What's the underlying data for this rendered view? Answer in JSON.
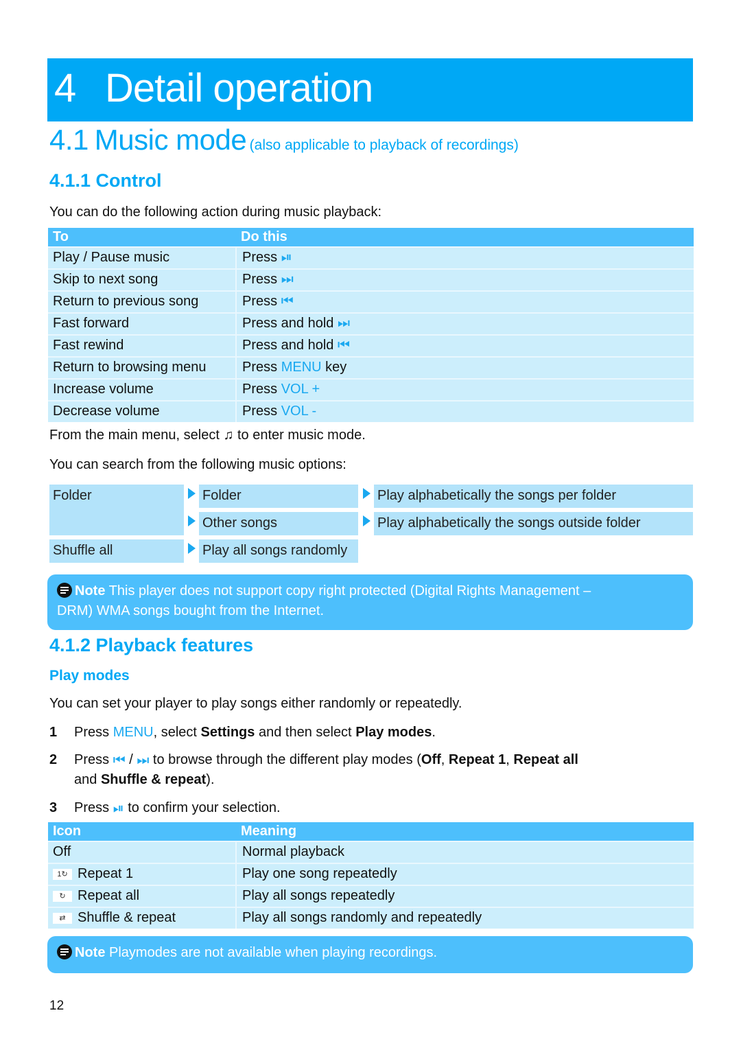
{
  "chapter": {
    "number": "4",
    "title": "Detail operation"
  },
  "section": {
    "number": "4.1",
    "title": "Music mode",
    "subtitle": "(also applicable to playback of recordings)"
  },
  "control": {
    "heading": "4.1.1 Control",
    "intro": "You can do the following action during music playback:",
    "table": {
      "headers": [
        "To",
        "Do this"
      ],
      "rows": [
        {
          "to": "Play / Pause music",
          "do": "Press",
          "key": "",
          "suffix": "",
          "icon": "play-pause-icon"
        },
        {
          "to": "Skip to next song",
          "do": "Press",
          "key": "",
          "suffix": "",
          "icon": "next-track-icon"
        },
        {
          "to": "Return to previous song",
          "do": "Press",
          "key": "",
          "suffix": "",
          "icon": "previous-track-icon"
        },
        {
          "to": "Fast forward",
          "do": "Press and hold",
          "key": "",
          "suffix": "",
          "icon": "next-track-icon"
        },
        {
          "to": "Fast rewind",
          "do": "Press and hold",
          "key": "",
          "suffix": "",
          "icon": "previous-track-icon"
        },
        {
          "to": "Return to browsing menu",
          "do": "Press",
          "key": "MENU",
          "suffix": "key",
          "icon": ""
        },
        {
          "to": "Increase volume",
          "do": "Press",
          "key": "VOL +",
          "suffix": "",
          "icon": ""
        },
        {
          "to": "Decrease volume",
          "do": "Press",
          "key": "VOL -",
          "suffix": "",
          "icon": ""
        }
      ]
    },
    "main_menu_pre": "From the main menu, select",
    "main_menu_post": "to enter music mode.",
    "search_intro": "You can search from the following music options:",
    "options": {
      "folder": "Folder",
      "folder_sub": "Folder",
      "folder_sub_desc": "Play alphabetically the songs per folder",
      "other_songs": "Other songs",
      "other_songs_desc": "Play alphabetically the songs outside folder",
      "shuffle_all": "Shuffle all",
      "shuffle_all_desc": "Play all songs randomly"
    },
    "note": {
      "label": "Note",
      "text": "This player does not support copy right protected (Digital Rights Management –",
      "text2": "DRM) WMA songs bought from the Internet."
    }
  },
  "playback": {
    "heading": "4.1.2 Playback features",
    "subheading": "Play modes",
    "intro": "You can set your player to play songs either randomly or repeatedly.",
    "steps": [
      {
        "n": "1",
        "parts": [
          "Press ",
          "MENU",
          ", select ",
          "Settings",
          " and then select ",
          "Play modes",
          "."
        ]
      },
      {
        "n": "2",
        "parts": [
          "Press ",
          " / ",
          " to browse through the different play modes (",
          "Off",
          ", ",
          "Repeat 1",
          ", ",
          "Repeat all"
        ],
        "line2": [
          "and ",
          "Shuffle & repeat",
          ")."
        ]
      },
      {
        "n": "3",
        "parts": [
          "Press ",
          " to confirm your selection."
        ]
      }
    ],
    "table": {
      "headers": [
        "Icon",
        "Meaning"
      ],
      "rows": [
        {
          "icon": "",
          "label": "Off",
          "meaning": "Normal playback"
        },
        {
          "icon": "repeat-one-icon",
          "label": "Repeat 1",
          "meaning": "Play one song repeatedly"
        },
        {
          "icon": "repeat-all-icon",
          "label": "Repeat all",
          "meaning": "Play all songs repeatedly"
        },
        {
          "icon": "shuffle-repeat-icon",
          "label": "Shuffle & repeat",
          "meaning": "Play all songs randomly and repeatedly"
        }
      ]
    },
    "note": {
      "label": "Note",
      "text": "Playmodes are not available when playing recordings."
    }
  },
  "page_number": "12",
  "colors": {
    "accent": "#00a8f5",
    "header": "#4dbffc",
    "row": "#cceefc",
    "option": "#b3e3fa"
  }
}
